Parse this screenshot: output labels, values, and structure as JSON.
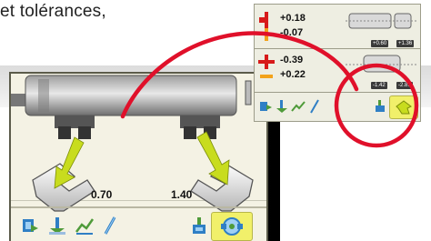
{
  "caption": {
    "text": "et tolérances,"
  },
  "main_screen": {
    "left_coupling_value": "0.70",
    "right_coupling_value": "1.40",
    "toolbar_icons": [
      "machine-select-icon",
      "alignment-icon",
      "chart-icon",
      "pen-icon",
      "settings-icon",
      "coupling-view-icon"
    ]
  },
  "inset_screen": {
    "rows": [
      {
        "value": "+0.18"
      },
      {
        "value": "-0.07"
      },
      {
        "value": "-0.39"
      },
      {
        "value": "+0.22"
      }
    ],
    "tags_top": [
      "+0.60",
      "+1.36"
    ],
    "tags_bottom": [
      "-1.42",
      "-2.81"
    ],
    "toolbar_icons": [
      "machine-select-icon",
      "alignment-icon",
      "chart-icon",
      "pen-icon",
      "settings-icon",
      "coupling-view-icon"
    ]
  },
  "colors": {
    "highlight": "#f1f06a",
    "annotation": "#e0102a",
    "arrow": "#c8dc1e",
    "icon_blue": "#2f7fc5",
    "icon_green": "#4f9b3a"
  }
}
